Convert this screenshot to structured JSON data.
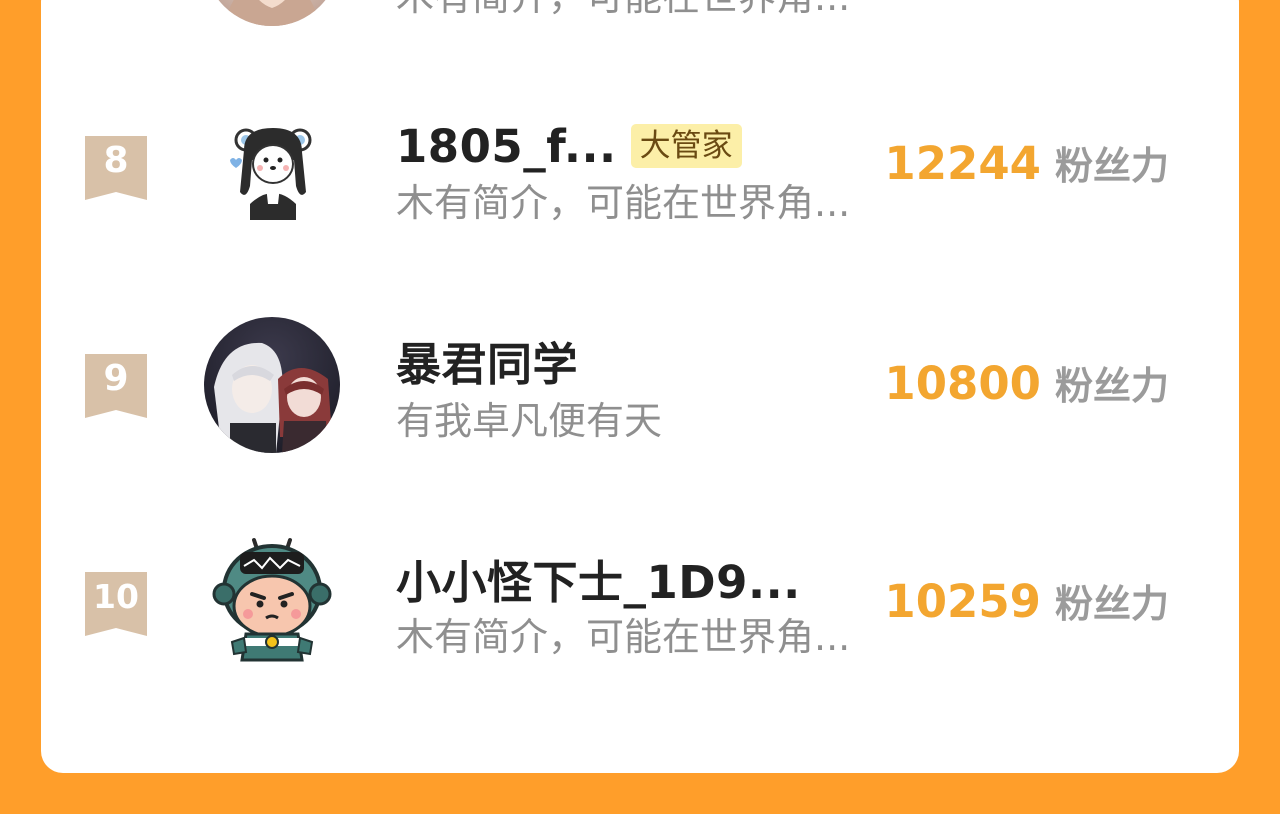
{
  "colors": {
    "background": "#FF9E2A",
    "card": "#ffffff",
    "fans_number": "#F3A630",
    "name": "#222222",
    "intro": "#8f8f8f",
    "tag_bg": "#FCEFA8",
    "rank_badge": "#D8C1A8"
  },
  "partial_row": {
    "intro": "木有简介，可能在世界角..."
  },
  "ranking": [
    {
      "rank": "8",
      "name": "1805_f...",
      "tag": "大管家",
      "intro": "木有简介，可能在世界角...",
      "fans": "12244",
      "fans_unit": "粉丝力",
      "avatar_icon": "bear-ear-girl-avatar"
    },
    {
      "rank": "9",
      "name": "暴君同学",
      "intro": "有我卓凡便有天",
      "fans": "10800",
      "fans_unit": "粉丝力",
      "avatar_icon": "anime-couple-avatar"
    },
    {
      "rank": "10",
      "name": "小小怪下士_1D9...",
      "intro": "木有简介，可能在世界角...",
      "fans": "10259",
      "fans_unit": "粉丝力",
      "avatar_icon": "little-monster-soldier-avatar"
    }
  ]
}
